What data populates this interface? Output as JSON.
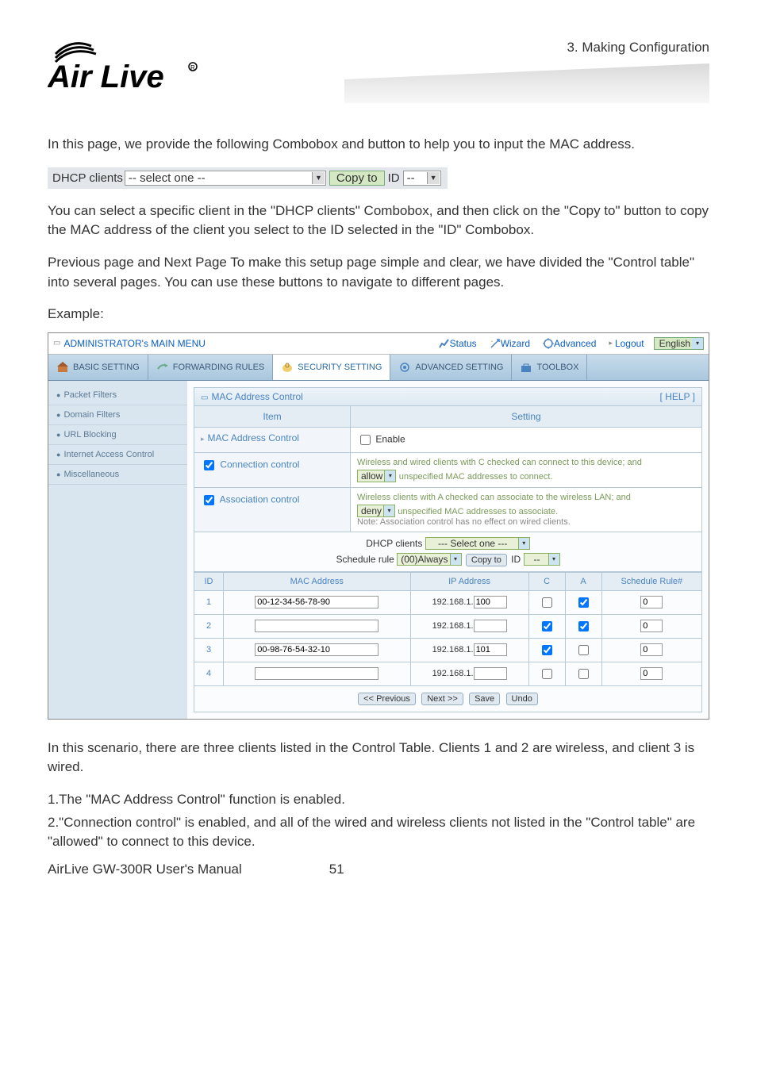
{
  "header": {
    "logo_alt": "Air Live",
    "breadcrumb": "3.  Making  Configuration"
  },
  "intro": {
    "p1": "In this page, we provide the following Combobox and button to help you to input the MAC address."
  },
  "dhcpBar": {
    "label": "DHCP clients",
    "select_value": "-- select one --",
    "copy_btn": "Copy to",
    "id_label": "ID",
    "id_select_value": "--"
  },
  "para2": "You can select a specific client in the \"DHCP clients\" Combobox, and then click on the \"Copy to\" button to copy the MAC address of the client you select to the ID selected in the \"ID\" Combobox.",
  "para3": "Previous page and Next Page   To make this setup page simple and clear, we have divided the \"Control table\" into several pages. You can use these buttons to navigate to different pages.",
  "example_label": "Example:",
  "adminTop": {
    "menu_title": "ADMINISTRATOR's MAIN MENU",
    "status": "Status",
    "wizard": "Wizard",
    "advanced": "Advanced",
    "logout": "Logout",
    "language": "English"
  },
  "tabs": {
    "basic": "BASIC SETTING",
    "forwarding": "FORWARDING RULES",
    "security": "SECURITY SETTING",
    "advanced": "ADVANCED SETTING",
    "toolbox": "TOOLBOX"
  },
  "leftNav": {
    "items": [
      "Packet Filters",
      "Domain Filters",
      "URL Blocking",
      "Internet Access Control",
      "Miscellaneous"
    ]
  },
  "section": {
    "title": "MAC Address Control",
    "help": "[ HELP ]",
    "item_hdr": "Item",
    "setting_hdr": "Setting",
    "mac_control_label": "MAC Address Control",
    "enable_label": "Enable",
    "conn_control_label": "Connection control",
    "conn_text1": "Wireless and wired clients with C checked can connect to this device; and",
    "conn_allow_select": "allow",
    "conn_text2": "unspecified MAC addresses to connect.",
    "assoc_control_label": "Association control",
    "assoc_text1": "Wireless clients with A checked can associate to the wireless LAN; and",
    "assoc_deny_select": "deny",
    "assoc_text2": "unspecified MAC addresses to associate.",
    "assoc_note": "Note: Association control has no effect on wired clients.",
    "dhcp_clients_label": "DHCP clients",
    "dhcp_select": "--- Select one ---",
    "schedule_rule_label": "Schedule rule",
    "schedule_select": "(00)Always",
    "copy_btn": "Copy to",
    "id_prefix": "ID",
    "id_select": "--"
  },
  "chart_data": {
    "type": "table",
    "columns": [
      "ID",
      "MAC Address",
      "IP Address",
      "C",
      "A",
      "Schedule Rule#"
    ],
    "rows": [
      {
        "id": 1,
        "mac": "00-12-34-56-78-90",
        "ip_prefix": "192.168.1.",
        "ip_last": "100",
        "c": false,
        "a": true,
        "rule": "0"
      },
      {
        "id": 2,
        "mac": "",
        "ip_prefix": "192.168.1.",
        "ip_last": "",
        "c": true,
        "a": true,
        "rule": "0"
      },
      {
        "id": 3,
        "mac": "00-98-76-54-32-10",
        "ip_prefix": "192.168.1.",
        "ip_last": "101",
        "c": true,
        "a": false,
        "rule": "0"
      },
      {
        "id": 4,
        "mac": "",
        "ip_prefix": "192.168.1.",
        "ip_last": "",
        "c": false,
        "a": false,
        "rule": "0"
      }
    ]
  },
  "table_headers": {
    "id": "ID",
    "mac": "MAC Address",
    "ip": "IP Address",
    "c": "C",
    "a": "A",
    "sched": "Schedule Rule#"
  },
  "buttons": {
    "prev": "<< Previous",
    "next": "Next >>",
    "save": "Save",
    "undo": "Undo"
  },
  "scenario": {
    "p1": "In this scenario, there are three clients listed in the Control Table. Clients 1 and 2 are wireless, and client 3 is wired.",
    "p2": "1.The \"MAC Address Control\" function is enabled.",
    "p3": "2.\"Connection control\" is enabled, and all of the wired and wireless clients not listed in the \"Control table\" are \"allowed\" to connect to this device."
  },
  "footer": {
    "left": "AirLive GW-300R User's Manual",
    "page": "51"
  }
}
